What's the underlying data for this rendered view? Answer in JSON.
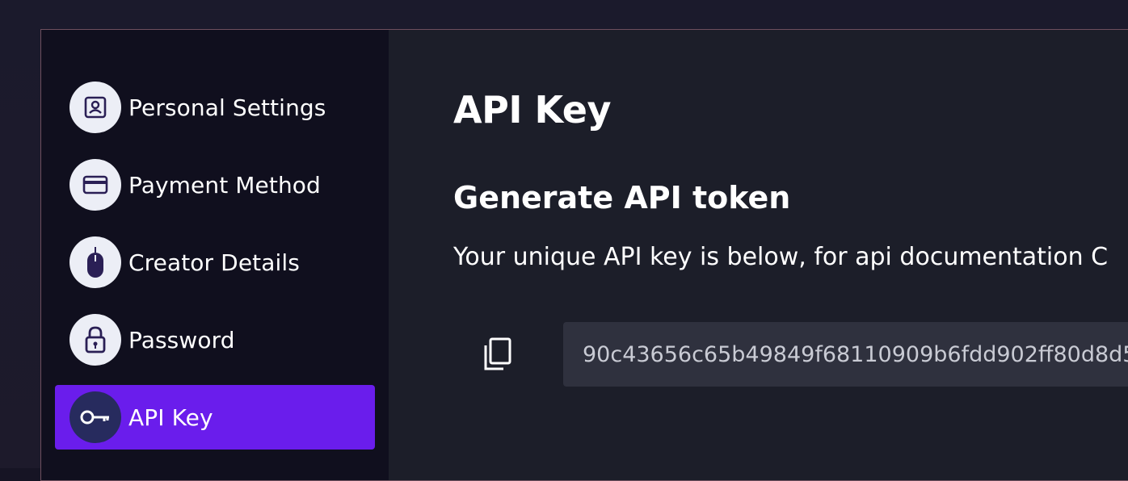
{
  "colors": {
    "accent": "#6a1dec",
    "sidebar_bg": "#100f1e",
    "main_bg": "#1c1e29",
    "field_bg": "#2f313e"
  },
  "sidebar": {
    "items": [
      {
        "label": "Personal Settings",
        "icon": "id-card-icon",
        "active": false
      },
      {
        "label": "Payment Method",
        "icon": "credit-card-icon",
        "active": false
      },
      {
        "label": "Creator Details",
        "icon": "mouse-icon",
        "active": false
      },
      {
        "label": "Password",
        "icon": "lock-icon",
        "active": false
      },
      {
        "label": "API Key",
        "icon": "key-icon",
        "active": true
      }
    ]
  },
  "main": {
    "title": "API Key",
    "subtitle": "Generate API token",
    "description": "Your unique API key is below, for api documentation C",
    "copy_icon": "copy-icon",
    "api_key_value": "90c43656c65b49849f68110909b6fdd902ff80d8d5"
  }
}
